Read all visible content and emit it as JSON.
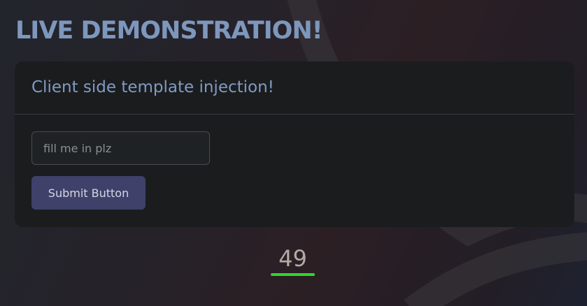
{
  "page": {
    "title": "LIVE DEMONSTRATION!"
  },
  "card": {
    "title": "Client side template injection!",
    "input": {
      "value": "",
      "placeholder": "fill me in plz"
    },
    "submit_label": "Submit Button"
  },
  "result": {
    "value": "49"
  },
  "colors": {
    "title": "#7d97bd",
    "card_background": "#1b1c1e",
    "button_background": "#3f416b",
    "result_underline": "#2ed62b"
  }
}
